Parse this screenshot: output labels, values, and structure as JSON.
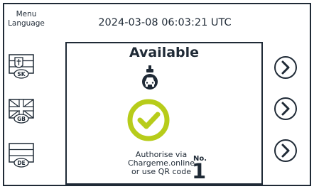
{
  "header": {
    "menu_language_label": "Menu\nLanguage",
    "datetime": "2024-03-08 06:03:21 UTC"
  },
  "languages": [
    {
      "code": "SK",
      "icon": "flag-sk-icon"
    },
    {
      "code": "GB",
      "icon": "flag-gb-icon"
    },
    {
      "code": "DE",
      "icon": "flag-de-icon"
    }
  ],
  "status": {
    "title": "Available",
    "instruction_line1": "Authorise via",
    "instruction_line2": "Chargeme.online",
    "instruction_line3": "or use QR code",
    "connector_label": "No.",
    "connector_number": "1"
  },
  "icons": {
    "car": "ev-car-icon",
    "check": "check-circle-icon",
    "arrow": "chevron-right-circle-icon"
  },
  "colors": {
    "text": "#1f2a36",
    "check": "#b7cc1a"
  }
}
